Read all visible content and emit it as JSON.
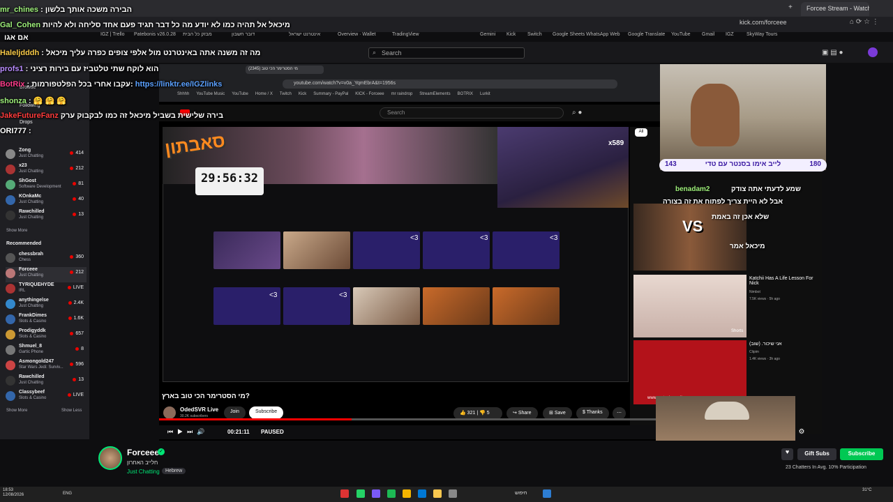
{
  "browser": {
    "tab_active": "Forcee Stream - Watch Live on",
    "url": "kick.com/forceee",
    "bookmarks": [
      "IGZ | Trello",
      "Patebonis v26.0.28",
      "מבזק כל הבית",
      "דובר חשבון",
      "אינטרנט ישראל",
      "Overview · Wallet",
      "TradingView",
      "Gemini",
      "Kick",
      "Switch",
      "Google Sheets",
      "WhatsApp Web",
      "Google Translate",
      "YouTube",
      "Gmail",
      "IGZ",
      "SkyWay Tours"
    ]
  },
  "twitch": {
    "search_placeholder": "Search",
    "sidebar": {
      "following_channels": [
        {
          "name": "Zong",
          "cat": "Just Chatting",
          "viewers": "414",
          "color": "#888"
        },
        {
          "name": "x23",
          "cat": "Just Chatting",
          "viewers": "212",
          "color": "#a33"
        },
        {
          "name": "ShGost",
          "cat": "Software Development",
          "viewers": "81",
          "color": "#5a7"
        },
        {
          "name": "KOnkaMc",
          "cat": "Just Chatting",
          "viewers": "40",
          "color": "#36a"
        },
        {
          "name": "Rawchilled",
          "cat": "Just Chatting",
          "viewers": "13",
          "color": "#333"
        }
      ],
      "show_more": "Show More",
      "recommended_label": "Recommended",
      "recommended": [
        {
          "name": "chessbrah",
          "cat": "Chess",
          "viewers": "360",
          "color": "#555"
        },
        {
          "name": "Forceee",
          "cat": "Just Chatting",
          "viewers": "212",
          "color": "#b77"
        },
        {
          "name": "TYRIQUEHYDE",
          "cat": "IRL",
          "viewers": "LIVE",
          "color": "#a33"
        },
        {
          "name": "anythingelse",
          "cat": "Just Chatting",
          "viewers": "2.4K",
          "color": "#38c"
        },
        {
          "name": "FrankDimes",
          "cat": "Slots & Casino",
          "viewers": "1.6K",
          "color": "#36a"
        },
        {
          "name": "Prodigyddk",
          "cat": "Slots & Casino",
          "viewers": "657",
          "color": "#c93"
        },
        {
          "name": "Shmuel_8",
          "cat": "Gartic Phone",
          "viewers": "8",
          "color": "#777"
        },
        {
          "name": "Asmongold247",
          "cat": "Star Wars Jedi: Surviv...",
          "viewers": "596",
          "color": "#c44"
        },
        {
          "name": "Rawchilled",
          "cat": "Just Chatting",
          "viewers": "13",
          "color": "#333"
        },
        {
          "name": "Classybeef",
          "cat": "Slots & Casino",
          "viewers": "LIVE",
          "color": "#36a"
        }
      ],
      "show_more2": "Show More",
      "show_less": "Show Less",
      "top_items": [
        "Browse",
        "Following",
        "Drops"
      ]
    }
  },
  "chat_overlay": [
    {
      "user": "mr_chines",
      "text": "הבירה משכה אותך בלשון"
    },
    {
      "user": "Gal_Cohen",
      "text": "מיכאל אל תהיה כמו לא יודע מה כל דבר תגיד פעם אחד סליחה ולא להיות"
    },
    {
      "user": "",
      "text": "אם אגו"
    },
    {
      "user": "Haleljdddh",
      "text": "מה זה משנה אתה באינטרנט מול אלפי צופים כפרה עליך מיכאל"
    },
    {
      "user": "profs1",
      "text": "הוא לוקח שתי טלטביז עם בירות רציני"
    },
    {
      "user": "BotRix",
      "text": "https://linktr.ee/IGZlinks"
    },
    {
      "user": "",
      "text": "עקבו אחרי בכל הפלטפורמות:"
    },
    {
      "user": "shonza",
      "text": "🤗 🤗 🤗"
    },
    {
      "user": "JakeFutureFanz",
      "text": "בירה שלישית בשביל מיכאל זה כמו לבקבוק ערק"
    },
    {
      "user": "ORI777",
      "text": ""
    }
  ],
  "inner": {
    "inner_url": "youtube.com/watch?v=v0a_YqmEbrA&t=1956s",
    "inner_tab": "מי הסטרימר הכי טוב (2345)",
    "inner_bookmarks": [
      "Shhhh",
      "YouTube Music",
      "YouTube",
      "Home / X",
      "Twitch",
      "Kick",
      "Summary - PayPal",
      "KICK - Forceee",
      "mr raindrop",
      "StreamElements",
      "BOTRIX",
      "Lurkit"
    ],
    "yt_search": "Search",
    "timer": "29:56:32",
    "logo_text": "סאבתון",
    "cam_badge": "x589",
    "thumb_labels": [
      "<3",
      "<3",
      "<3",
      "<3",
      "<3"
    ],
    "yt_filter": "All"
  },
  "video": {
    "title": "מי הסטרימר הכי טוב בארץ?",
    "channel": "OdedSVR Live",
    "subs": "30.2K subscribers",
    "join": "Join",
    "subscribe": "Subscribe",
    "likes": "321",
    "dislikes": "5",
    "share": "Share",
    "save": "Save",
    "thanks": "Thanks",
    "time": "00:21:11",
    "state": "PAUSED",
    "progress": 0.385
  },
  "yt_sidebar": [
    {
      "title": "Katchii Has A Life Lesson For Nick",
      "meta": "Nimbot",
      "age": "7.5K views · 5h ago"
    },
    {
      "title": "אני שיכור. (שוב)",
      "meta": "Clipim",
      "age": "1.4K views · 3h ago"
    }
  ],
  "overlay": {
    "bar_left": "143",
    "bar_text": "לייב אימו בסנטר עם טדי",
    "bar_right": "180",
    "chat1_user": "benadam2",
    "chat1": "שמע לדעתי אתה צודק",
    "chat2": "אבל לא היית צריך לפתוח את זה בצורה",
    "chat3": "שלא אכן זה באמת",
    "chat4": "מיכאל אמר",
    "vs": "VS",
    "shorts": "Shorts",
    "wm": "www.srutanim.co.il"
  },
  "streamer": {
    "name": "Forceee",
    "bio": "חלייב האחרון",
    "category": "Just Chatting",
    "tag": "Hebrew",
    "gift": "Gift Subs",
    "subscribe": "Subscribe",
    "chatters": "Chatters In Avg.",
    "participation": "% Participation",
    "chatters_val": "23",
    "participation_val": "10"
  },
  "taskbar": {
    "time": "18:53",
    "date": "12/08/2026",
    "lang": "ENG",
    "search": "חיפוש",
    "weather": "31°C"
  }
}
